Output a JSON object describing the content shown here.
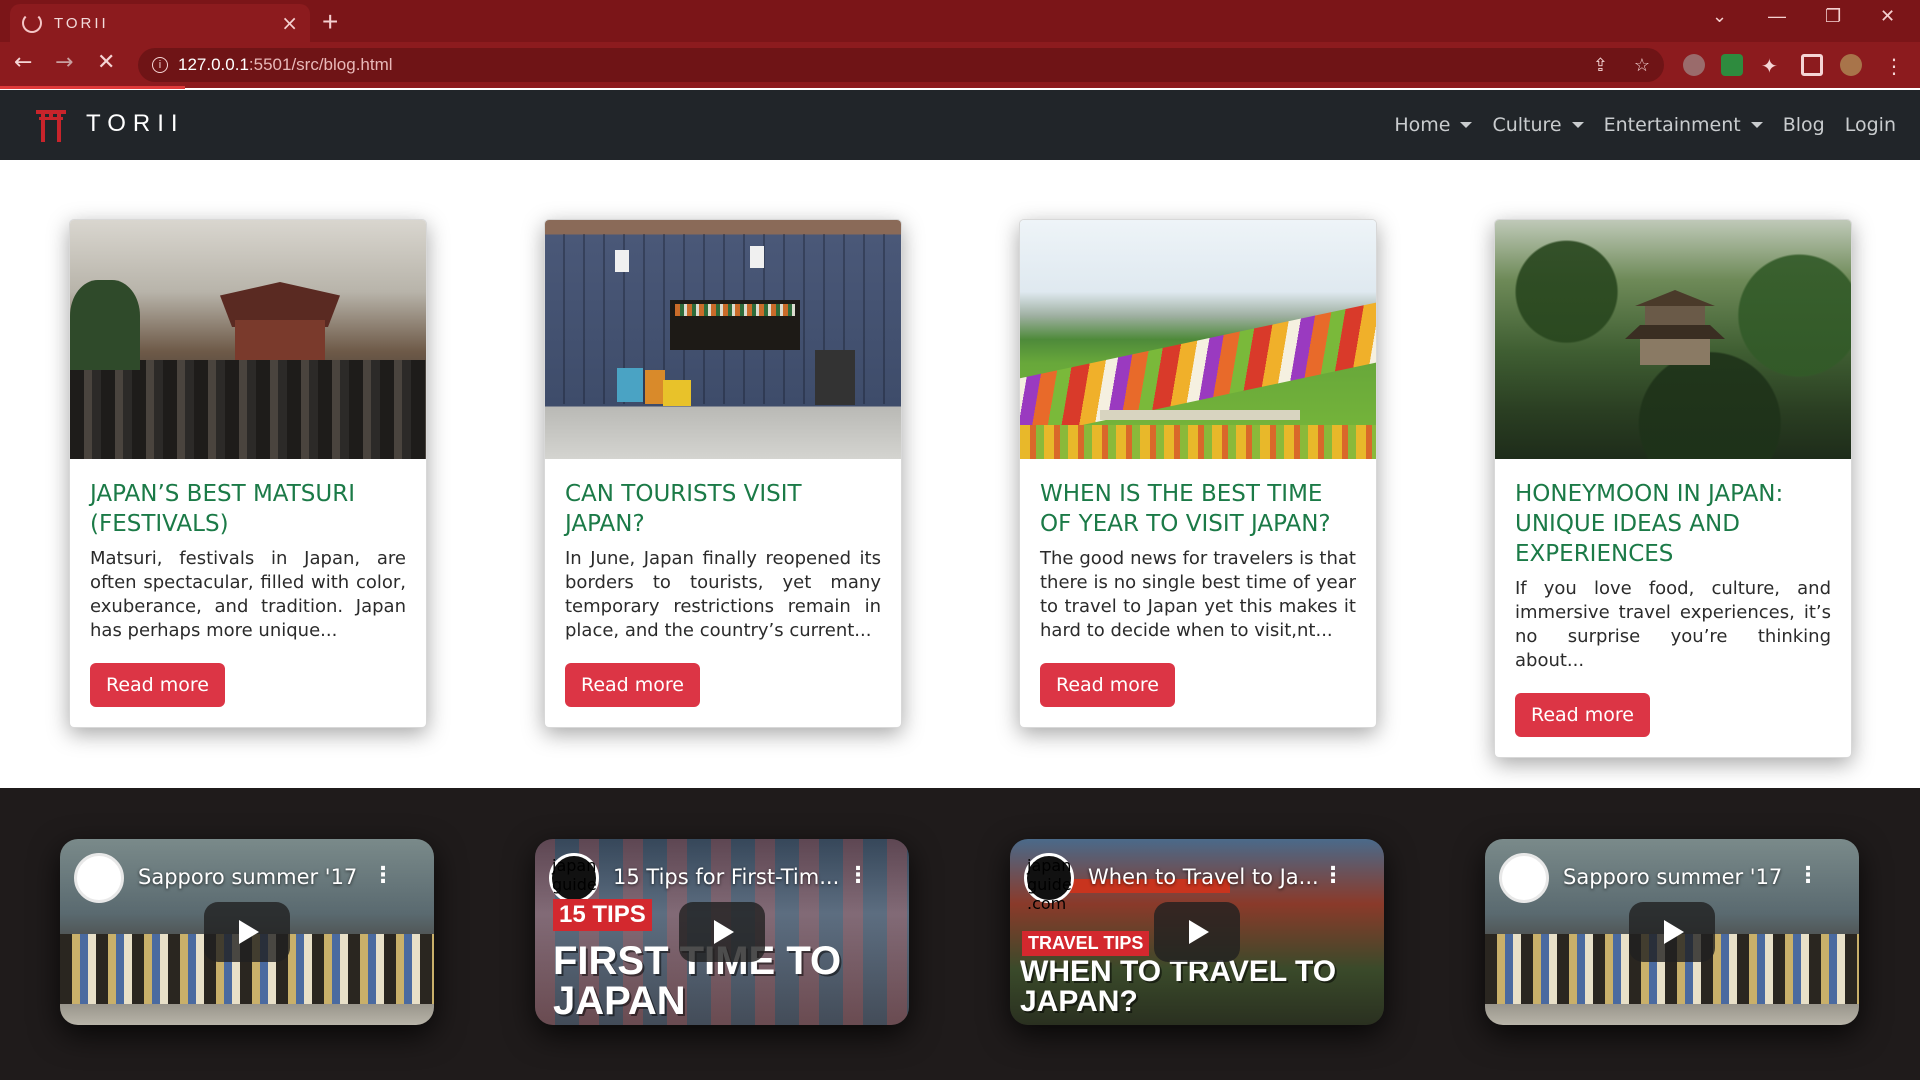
{
  "browser": {
    "tab_title": "TORII",
    "tab_close": "×",
    "new_tab": "+",
    "url_host": "127.0.0.1",
    "url_path": ":5501/src/blog.html"
  },
  "navbar": {
    "brand": "TORII",
    "items": [
      {
        "label": "Home",
        "dropdown": true
      },
      {
        "label": "Culture",
        "dropdown": true
      },
      {
        "label": "Entertainment",
        "dropdown": true
      },
      {
        "label": "Blog",
        "dropdown": false
      },
      {
        "label": "Login",
        "dropdown": false
      }
    ]
  },
  "cards": [
    {
      "title": "JAPAN’S BEST MATSURI (FESTIVALS)",
      "text": "Matsuri, festivals in Japan, are often spectacular, filled with color, exuberance, and tradition. Japan has perhaps more unique...",
      "button": "Read more",
      "image": "festival-crowd-image"
    },
    {
      "title": "CAN TOURISTS VISIT JAPAN?",
      "text": "In June, Japan finally reopened its borders to tourists, yet many temporary restrictions remain in place, and the country’s current...",
      "button": "Read more",
      "image": "street-shop-image"
    },
    {
      "title": "WHEN IS THE BEST TIME OF YEAR TO VISIT JAPAN?",
      "text": "The good news for travelers is that there is no single best time of year to travel to Japan yet this makes it hard to decide when to visit,nt...",
      "button": "Read more",
      "image": "flower-fields-image"
    },
    {
      "title": "HONEYMOON IN JAPAN: UNIQUE IDEAS AND EXPERIENCES",
      "text": "If you love food, culture, and immersive travel experiences, it’s no surprise you’re thinking about...",
      "button": "Read more",
      "image": "temple-garden-image"
    }
  ],
  "videos": [
    {
      "title": "Sapporo summer '17",
      "channel": "",
      "overlay_badge": "",
      "overlay_big": ""
    },
    {
      "title": "15 Tips for First-Tim...",
      "channel": "japan guide .com",
      "overlay_badge": "15 TIPS",
      "overlay_big": "FIRST TIME TO JAPAN"
    },
    {
      "title": "When to Travel to Ja...",
      "channel": "japan guide .com",
      "overlay_badge": "TRAVEL TIPS",
      "overlay_big": "WHEN TO TRAVEL TO JAPAN?"
    },
    {
      "title": "Sapporo summer '17",
      "channel": "",
      "overlay_badge": "",
      "overlay_big": ""
    }
  ],
  "colors": {
    "tab_bar": "#7b1518",
    "navbar": "#212529",
    "card_title": "#1b7a47",
    "button": "#dc3545",
    "video_section": "#1f1b1b"
  }
}
